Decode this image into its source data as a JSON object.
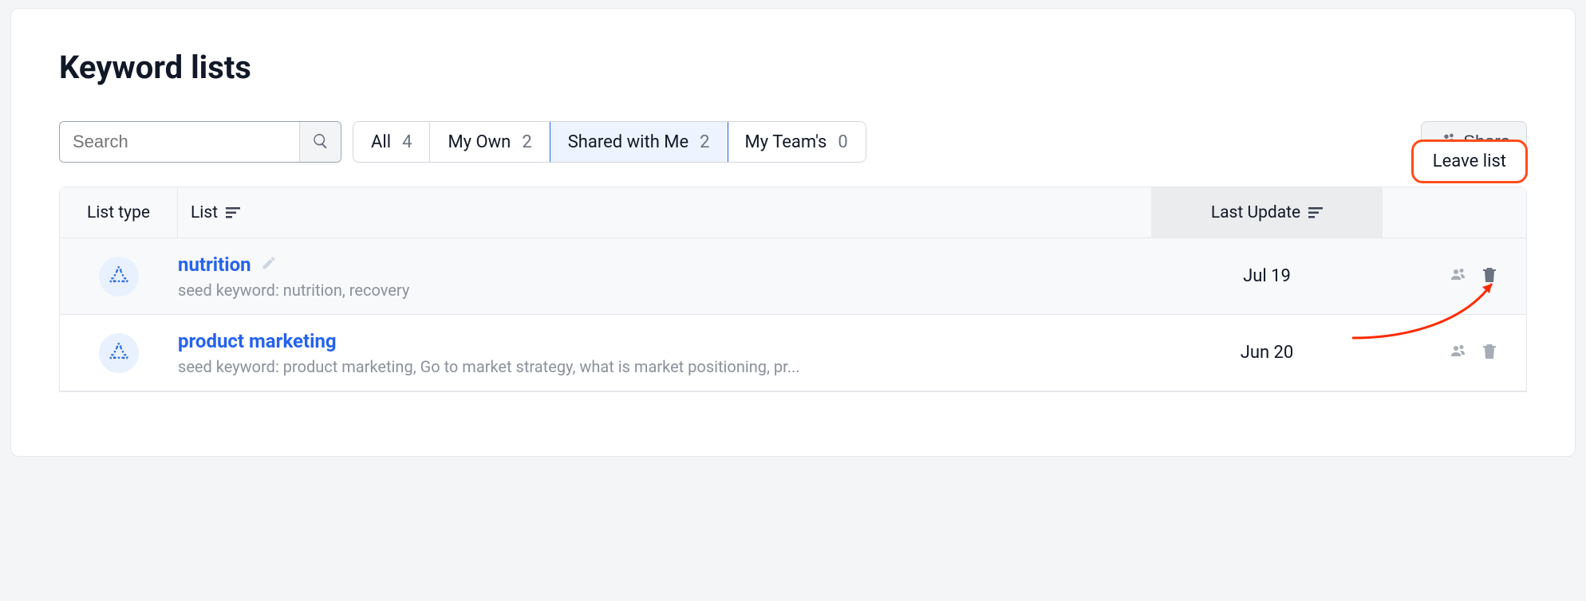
{
  "page": {
    "title": "Keyword lists"
  },
  "search": {
    "placeholder": "Search"
  },
  "tabs": [
    {
      "label": "All",
      "count": "4"
    },
    {
      "label": "My Own",
      "count": "2"
    },
    {
      "label": "Shared with Me",
      "count": "2"
    },
    {
      "label": "My Team's",
      "count": "0"
    }
  ],
  "share": {
    "label": "Share"
  },
  "columns": {
    "list_type": "List type",
    "list": "List",
    "last_update": "Last Update"
  },
  "tooltip": {
    "leave_list": "Leave list"
  },
  "rows": [
    {
      "title": "nutrition",
      "sub": "seed keyword: nutrition, recovery",
      "date": "Jul 19"
    },
    {
      "title": "product marketing",
      "sub": "seed keyword: product marketing, Go to market strategy, what is market positioning, pr...",
      "date": "Jun 20"
    }
  ]
}
